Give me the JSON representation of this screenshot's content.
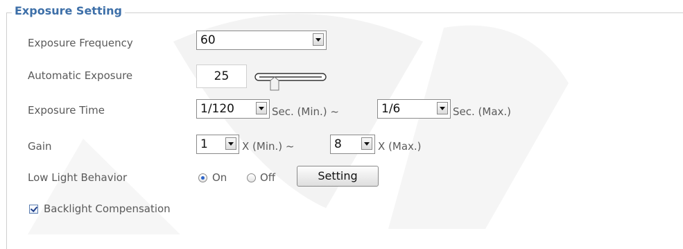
{
  "section": {
    "title": "Exposure Setting"
  },
  "exposure_frequency": {
    "label": "Exposure Frequency",
    "value": "60"
  },
  "automatic_exposure": {
    "label": "Automatic Exposure",
    "value": "25"
  },
  "exposure_time": {
    "label": "Exposure Time",
    "min_value": "1/120",
    "min_unit": "Sec.  (Min.) ~",
    "max_value": "1/6",
    "max_unit": "Sec.  (Max.)"
  },
  "gain": {
    "label": "Gain",
    "min_value": "1",
    "min_unit": "X  (Min.) ~",
    "max_value": "8",
    "max_unit": "X  (Max.)"
  },
  "low_light": {
    "label": "Low Light Behavior",
    "on_label": "On",
    "off_label": "Off",
    "selected": "On",
    "button_label": "Setting"
  },
  "backlight": {
    "label": "Backlight Compensation",
    "checked": true
  },
  "colors": {
    "title": "#3d6fa8",
    "text": "#5a5a5a",
    "border": "#8a8a8a"
  }
}
